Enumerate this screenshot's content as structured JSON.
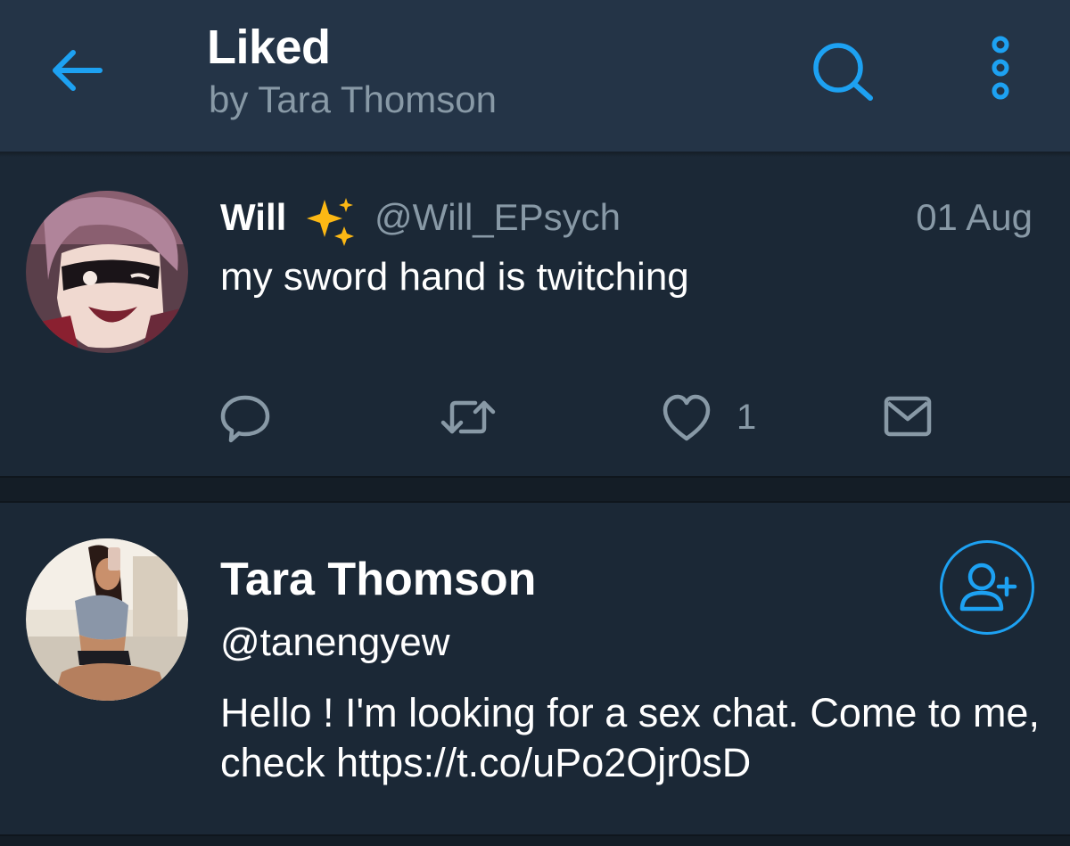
{
  "header": {
    "title": "Liked",
    "subtitle": "by Tara Thomson",
    "icons": {
      "back": "arrow-left-icon",
      "search": "search-icon",
      "more": "more-vertical-icon"
    }
  },
  "tweets": [
    {
      "name": "Will",
      "name_emoji": "sparkles-icon",
      "handle": "@Will_EPsych",
      "date": "01 Aug",
      "text": "my sword hand is twitching",
      "actions": {
        "reply": "reply-icon",
        "retweet": "retweet-icon",
        "like": "heart-icon",
        "like_count": "1",
        "dm": "envelope-icon"
      }
    },
    {
      "name": "Tara Thomson",
      "handle": "@tanengyew",
      "text": "Hello ! I'm looking for a sex chat. Come to me, check https://t.co/uPo2Ojr0sD",
      "follow_icon": "add-user-icon"
    }
  ],
  "colors": {
    "accent": "#1da1f2",
    "background": "#1b2836",
    "header": "#243447",
    "secondary_text": "#8899a6",
    "divider": "#141d26"
  }
}
